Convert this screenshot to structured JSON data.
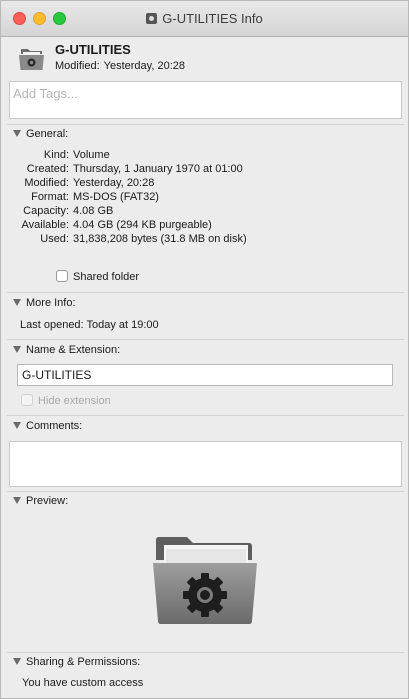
{
  "window": {
    "title": "G-UTILITIES Info"
  },
  "header": {
    "name": "G-UTILITIES",
    "modified_label": "Modified:",
    "modified_value": "Yesterday, 20:28"
  },
  "tags": {
    "placeholder": "Add Tags..."
  },
  "sections": {
    "general": "General:",
    "more_info": "More Info:",
    "name_extension": "Name & Extension:",
    "comments": "Comments:",
    "preview": "Preview:",
    "sharing": "Sharing & Permissions:"
  },
  "general": {
    "rows": [
      {
        "key": "Kind:",
        "value": "Volume"
      },
      {
        "key": "Created:",
        "value": "Thursday, 1 January 1970 at 01:00"
      },
      {
        "key": "Modified:",
        "value": "Yesterday, 20:28"
      },
      {
        "key": "Format:",
        "value": "MS-DOS (FAT32)"
      },
      {
        "key": "Capacity:",
        "value": "4.08 GB"
      },
      {
        "key": "Available:",
        "value": "4.04 GB (294 KB purgeable)"
      },
      {
        "key": "Used:",
        "value": "31,838,208 bytes (31.8 MB on disk)"
      }
    ],
    "shared_folder_label": "Shared folder",
    "shared_folder_checked": false
  },
  "more_info": {
    "last_opened": "Last opened: Today at 19:00"
  },
  "name_extension": {
    "name_value": "G-UTILITIES",
    "hide_extension_label": "Hide extension",
    "hide_extension_checked": false
  },
  "comments": {
    "value": ""
  },
  "sharing": {
    "access_text": "You have custom access"
  },
  "colors": {
    "close": "#fc5f57",
    "minimize": "#fdbc2e",
    "maximize": "#28c941"
  }
}
